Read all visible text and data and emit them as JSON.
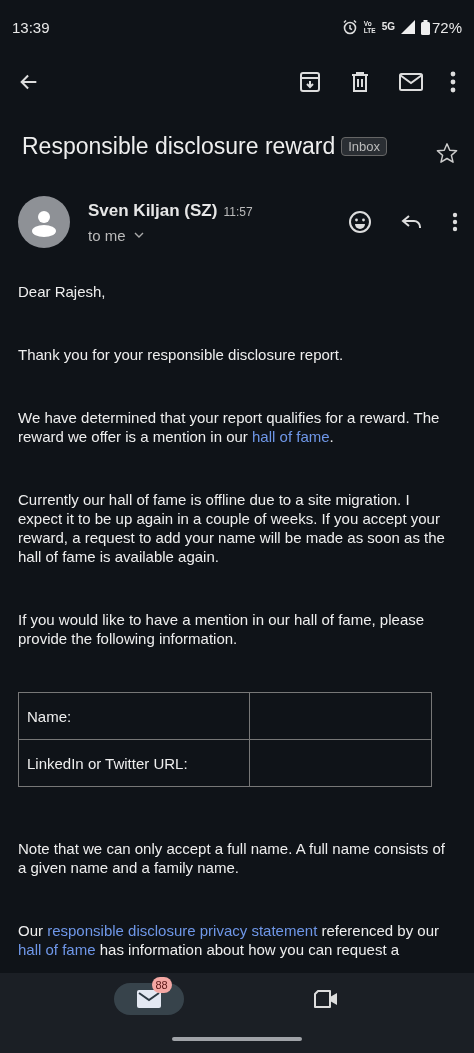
{
  "status_bar": {
    "time": "13:39",
    "volte": [
      "Vo",
      "LTE"
    ],
    "network": "5G",
    "battery": "72%"
  },
  "subject": {
    "title": "Responsible disclosure reward",
    "label": "Inbox",
    "starred": false
  },
  "sender": {
    "name": "Sven Kiljan (SZ)",
    "time": "11:57",
    "recipient": "to me"
  },
  "body": [
    {
      "kind": "text",
      "parts": [
        {
          "text": "Dear Rajesh,",
          "link": false
        }
      ]
    },
    {
      "kind": "text",
      "parts": [
        {
          "text": "Thank you for your responsible disclosure report.",
          "link": false
        }
      ]
    },
    {
      "kind": "text",
      "parts": [
        {
          "text": "We have determined that your report qualifies for a reward. The reward we offer is a mention in our ",
          "link": false
        },
        {
          "text": "hall of fame",
          "link": true
        },
        {
          "text": ".",
          "link": false
        }
      ]
    },
    {
      "kind": "text",
      "parts": [
        {
          "text": "Currently our hall of fame is offline due to a site migration. I expect it to be up again in a couple of weeks. If you accept your reward, a request to add your name will be made as soon as the hall of fame is available again.",
          "link": false
        }
      ]
    },
    {
      "kind": "text",
      "parts": [
        {
          "text": "If you would like to have a mention in our hall of fame, please provide the following information.",
          "link": false
        }
      ]
    },
    {
      "kind": "table",
      "rows": [
        {
          "label": "Name:"
        },
        {
          "label": "LinkedIn or Twitter URL:"
        }
      ]
    },
    {
      "kind": "text",
      "parts": [
        {
          "text": "Note that we can only accept a full name. A full name consists of a given name and a family name.",
          "link": false
        }
      ]
    },
    {
      "kind": "text",
      "parts": [
        {
          "text": "Our ",
          "link": false
        },
        {
          "text": "responsible disclosure privacy statement",
          "link": true
        },
        {
          "text": " referenced by our ",
          "link": false
        },
        {
          "text": "hall of fame",
          "link": true
        },
        {
          "text": " has information about how you can request a",
          "link": false
        }
      ]
    }
  ],
  "nav": [
    {
      "kind": "mail",
      "selected": true,
      "badge": "88"
    },
    {
      "kind": "video",
      "selected": false
    }
  ]
}
